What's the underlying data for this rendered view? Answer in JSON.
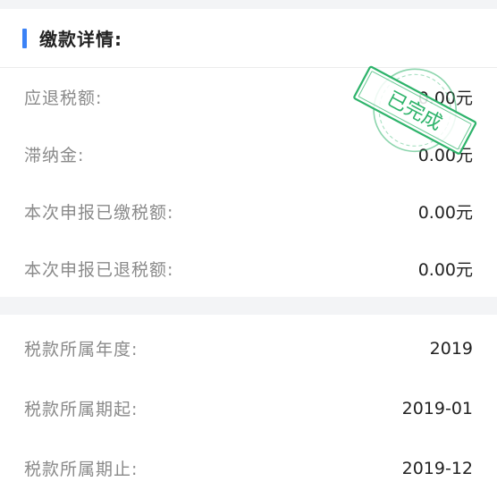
{
  "header": {
    "title": "缴款详情:"
  },
  "payment_rows": [
    {
      "label": "应退税额:",
      "value": "0.00元"
    },
    {
      "label": "滞纳金:",
      "value": "0.00元"
    },
    {
      "label": "本次申报已缴税额:",
      "value": "0.00元"
    },
    {
      "label": "本次申报已退税额:",
      "value": "0.00元"
    }
  ],
  "period_rows": [
    {
      "label": "税款所属年度:",
      "value": "2019"
    },
    {
      "label": "税款所属期起:",
      "value": "2019-01"
    },
    {
      "label": "税款所属期止:",
      "value": "2019-12"
    }
  ],
  "stamp": {
    "text": "已完成",
    "color": "#2db36a"
  },
  "colors": {
    "accent": "#3b82f6",
    "background": "#f3f4f6",
    "label": "#8a8a8a",
    "value": "#222222"
  }
}
